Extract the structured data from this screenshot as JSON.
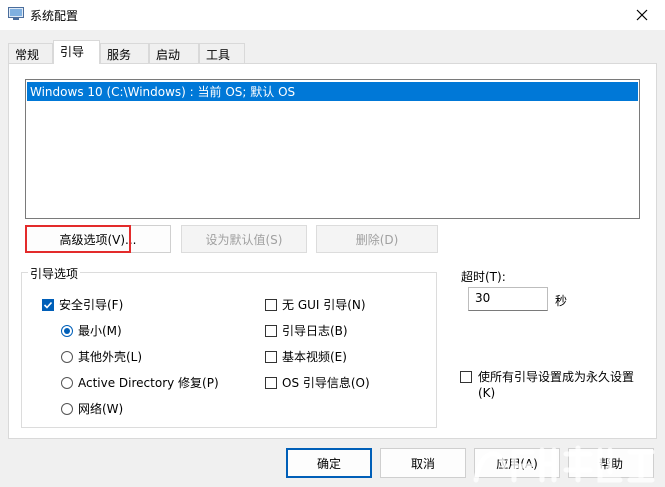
{
  "window": {
    "title": "系统配置",
    "close_icon": "close-icon",
    "app_icon": "system-config-icon"
  },
  "tabs": [
    {
      "label": "常规",
      "active": false
    },
    {
      "label": "引导",
      "active": true
    },
    {
      "label": "服务",
      "active": false
    },
    {
      "label": "启动",
      "active": false
    },
    {
      "label": "工具",
      "active": false
    }
  ],
  "boot_list": {
    "items": [
      "Windows 10 (C:\\Windows) : 当前 OS; 默认 OS"
    ],
    "selected_index": 0
  },
  "buttons": {
    "advanced": "高级选项(V)...",
    "set_default": "设为默认值(S)",
    "delete": "删除(D)"
  },
  "boot_options": {
    "legend": "引导选项",
    "safe_boot": {
      "label": "安全引导(F)",
      "checked": true
    },
    "minimal": {
      "label": "最小(M)",
      "selected": true
    },
    "alternate_shell": {
      "label": "其他外壳(L)",
      "selected": false
    },
    "active_directory": {
      "label": "Active Directory 修复(P)",
      "selected": false
    },
    "network": {
      "label": "网络(W)",
      "selected": false
    },
    "no_gui": {
      "label": "无 GUI 引导(N)",
      "checked": false
    },
    "boot_log": {
      "label": "引导日志(B)",
      "checked": false
    },
    "base_video": {
      "label": "基本视频(E)",
      "checked": false
    },
    "os_info": {
      "label": "OS 引导信息(O)",
      "checked": false
    }
  },
  "timeout": {
    "label": "超时(T):",
    "value": "30",
    "unit": "秒"
  },
  "permanent": {
    "label": "使所有引导设置成为永久设置(K)",
    "checked": false
  },
  "footer": {
    "ok": "确定",
    "cancel": "取消",
    "apply": "应用(A)",
    "help": "帮助"
  },
  "colors": {
    "selection": "#0078d7",
    "accent": "#005fb8",
    "highlight_box": "#e32b2b"
  }
}
